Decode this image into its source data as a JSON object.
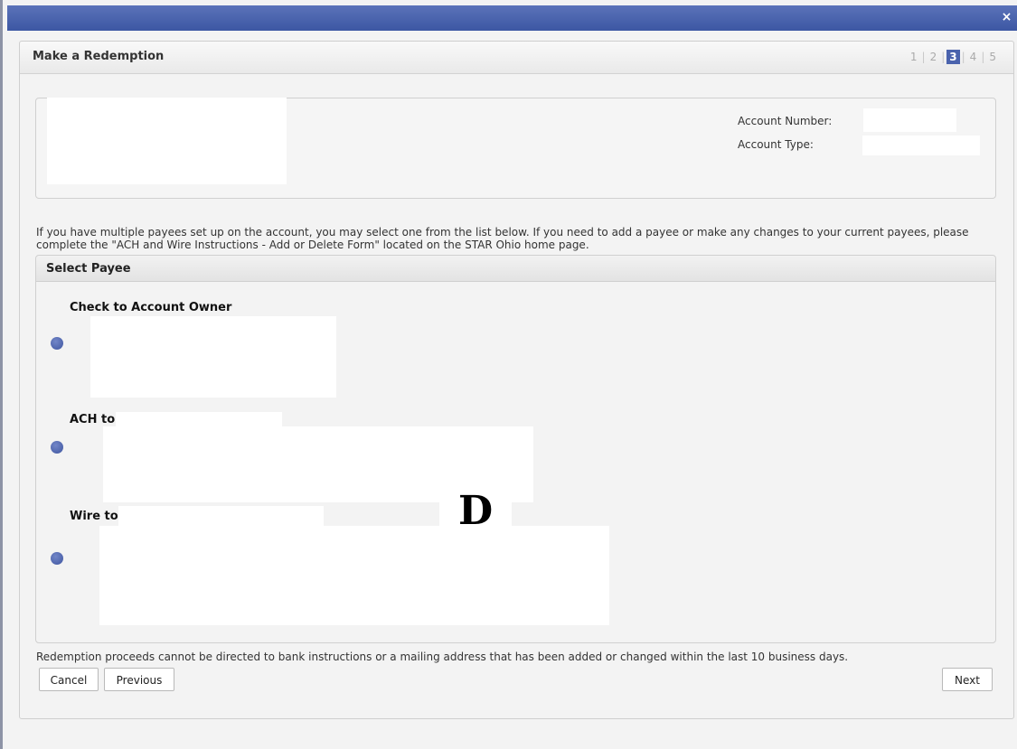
{
  "window": {
    "close_symbol": "×"
  },
  "header": {
    "title": "Make a Redemption",
    "steps": [
      "1",
      "2",
      "3",
      "4",
      "5"
    ],
    "current_step": "3"
  },
  "account": {
    "number_label": "Account Number:",
    "type_label": "Account Type:"
  },
  "instructions": "If you have multiple payees set up on the account, you may select one from the list below. If you need to add a payee or make any changes to your current payees, please complete the \"ACH and Wire Instructions - Add or Delete Form\" located on the STAR Ohio home page.",
  "payee": {
    "section_title": "Select Payee",
    "options": [
      {
        "label": "Check to Account Owner"
      },
      {
        "label": "ACH to"
      },
      {
        "label": "Wire to"
      }
    ]
  },
  "watermark": "D",
  "footnote": "Redemption proceeds cannot be directed to bank instructions or a mailing address that has been added or changed within the last 10 business days.",
  "buttons": {
    "cancel": "Cancel",
    "previous": "Previous",
    "next": "Next"
  },
  "colors": {
    "titlebar": "#4a63ad",
    "radio": "#4a5fa8",
    "active_step": "#4a63ad"
  }
}
